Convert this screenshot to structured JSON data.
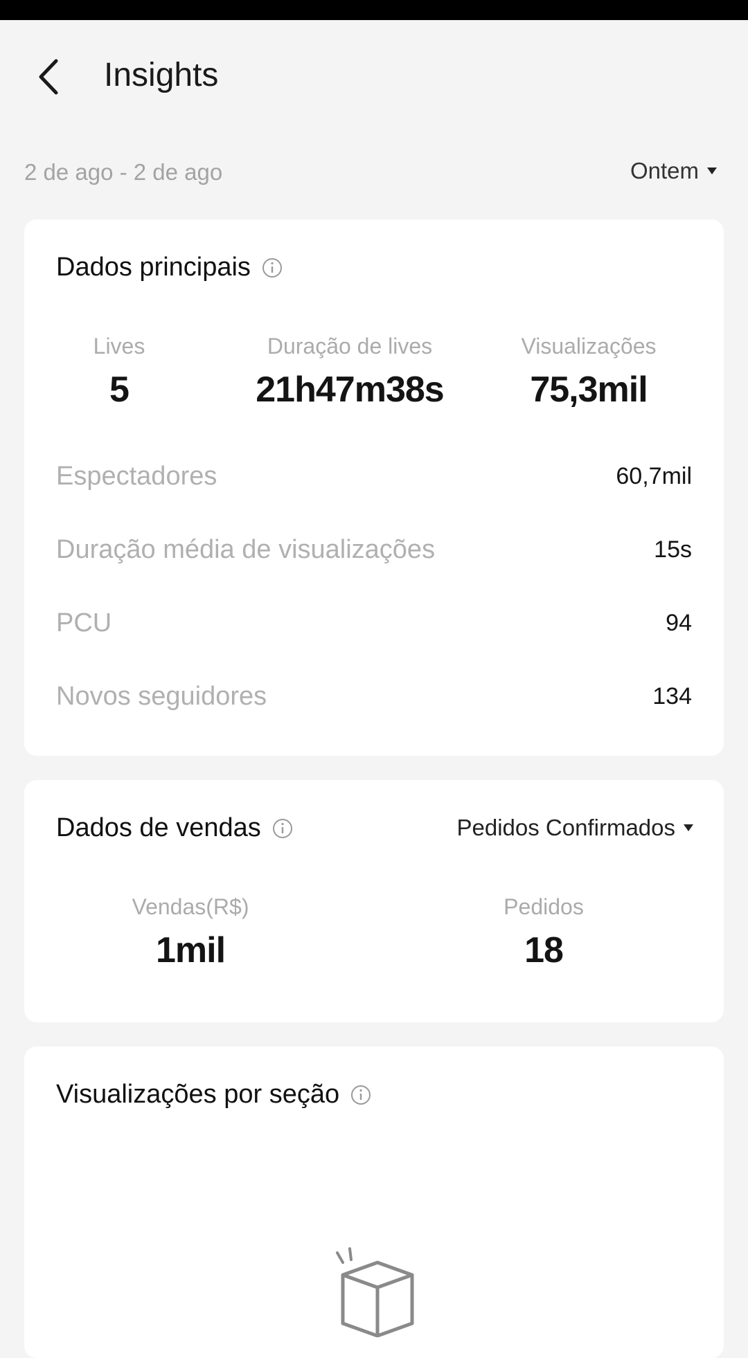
{
  "header": {
    "title": "Insights"
  },
  "date_filter": {
    "range": "2 de ago - 2 de ago",
    "period": "Ontem"
  },
  "main_data": {
    "title": "Dados principais",
    "metrics": [
      {
        "label": "Lives",
        "value": "5"
      },
      {
        "label": "Duração de lives",
        "value": "21h47m38s"
      },
      {
        "label": "Visualizações",
        "value": "75,3mil"
      }
    ],
    "stats": [
      {
        "label": "Espectadores",
        "value": "60,7mil"
      },
      {
        "label": "Duração média de visualizações",
        "value": "15s"
      },
      {
        "label": "PCU",
        "value": "94"
      },
      {
        "label": "Novos seguidores",
        "value": "134"
      }
    ]
  },
  "sales_data": {
    "title": "Dados de vendas",
    "filter": "Pedidos Confirmados",
    "metrics": [
      {
        "label": "Vendas(R$)",
        "value": "1mil"
      },
      {
        "label": "Pedidos",
        "value": "18"
      }
    ]
  },
  "views_by_section": {
    "title": "Visualizações por seção"
  },
  "icons": {
    "back": "chevron-left-icon",
    "info": "info-icon",
    "caret": "caret-down-icon",
    "empty": "empty-box-icon"
  }
}
